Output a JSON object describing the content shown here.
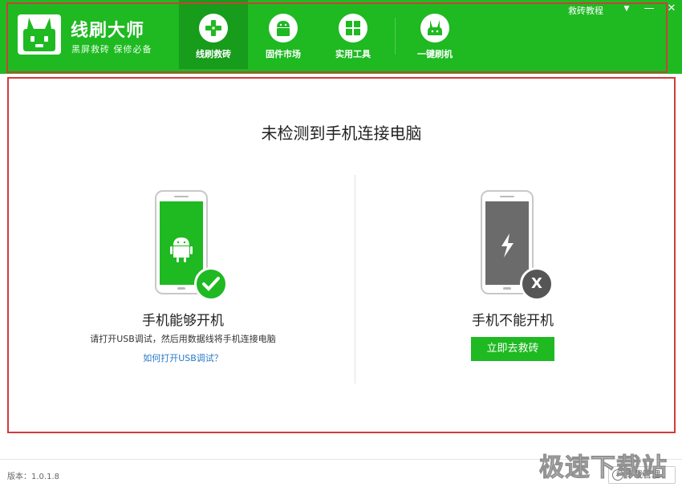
{
  "app": {
    "title": "线刷大师",
    "slogan": "黑屏救砖   保修必备"
  },
  "nav": [
    {
      "label": "线刷救砖",
      "icon": "rescue-icon",
      "active": true
    },
    {
      "label": "固件市场",
      "icon": "android-icon",
      "active": false
    },
    {
      "label": "实用工具",
      "icon": "grid-icon",
      "active": false
    },
    {
      "label": "一键刷机",
      "icon": "rabbit-icon",
      "active": false
    }
  ],
  "window": {
    "help_link": "救砖教程",
    "dropdown": "▼",
    "minimize": "—",
    "close": "✕"
  },
  "main": {
    "title": "未检测到手机连接电脑",
    "left": {
      "title": "手机能够开机",
      "desc": "请打开USB调试，然后用数据线将手机连接电脑",
      "link": "如何打开USB调试？"
    },
    "right": {
      "title": "手机不能开机",
      "button": "立即去救砖",
      "status_mark": "X"
    }
  },
  "footer": {
    "version": "版本：1.0.1.8",
    "download_manager": "下载管理",
    "download_icon": "⇩"
  },
  "watermark": "极速下载站",
  "colors": {
    "brand_green": "#1fb922",
    "active_tab": "#179c1b",
    "link_blue": "#2a79c6",
    "phone_off": "#6b6b6b",
    "outline_red": "#d33b3b"
  }
}
